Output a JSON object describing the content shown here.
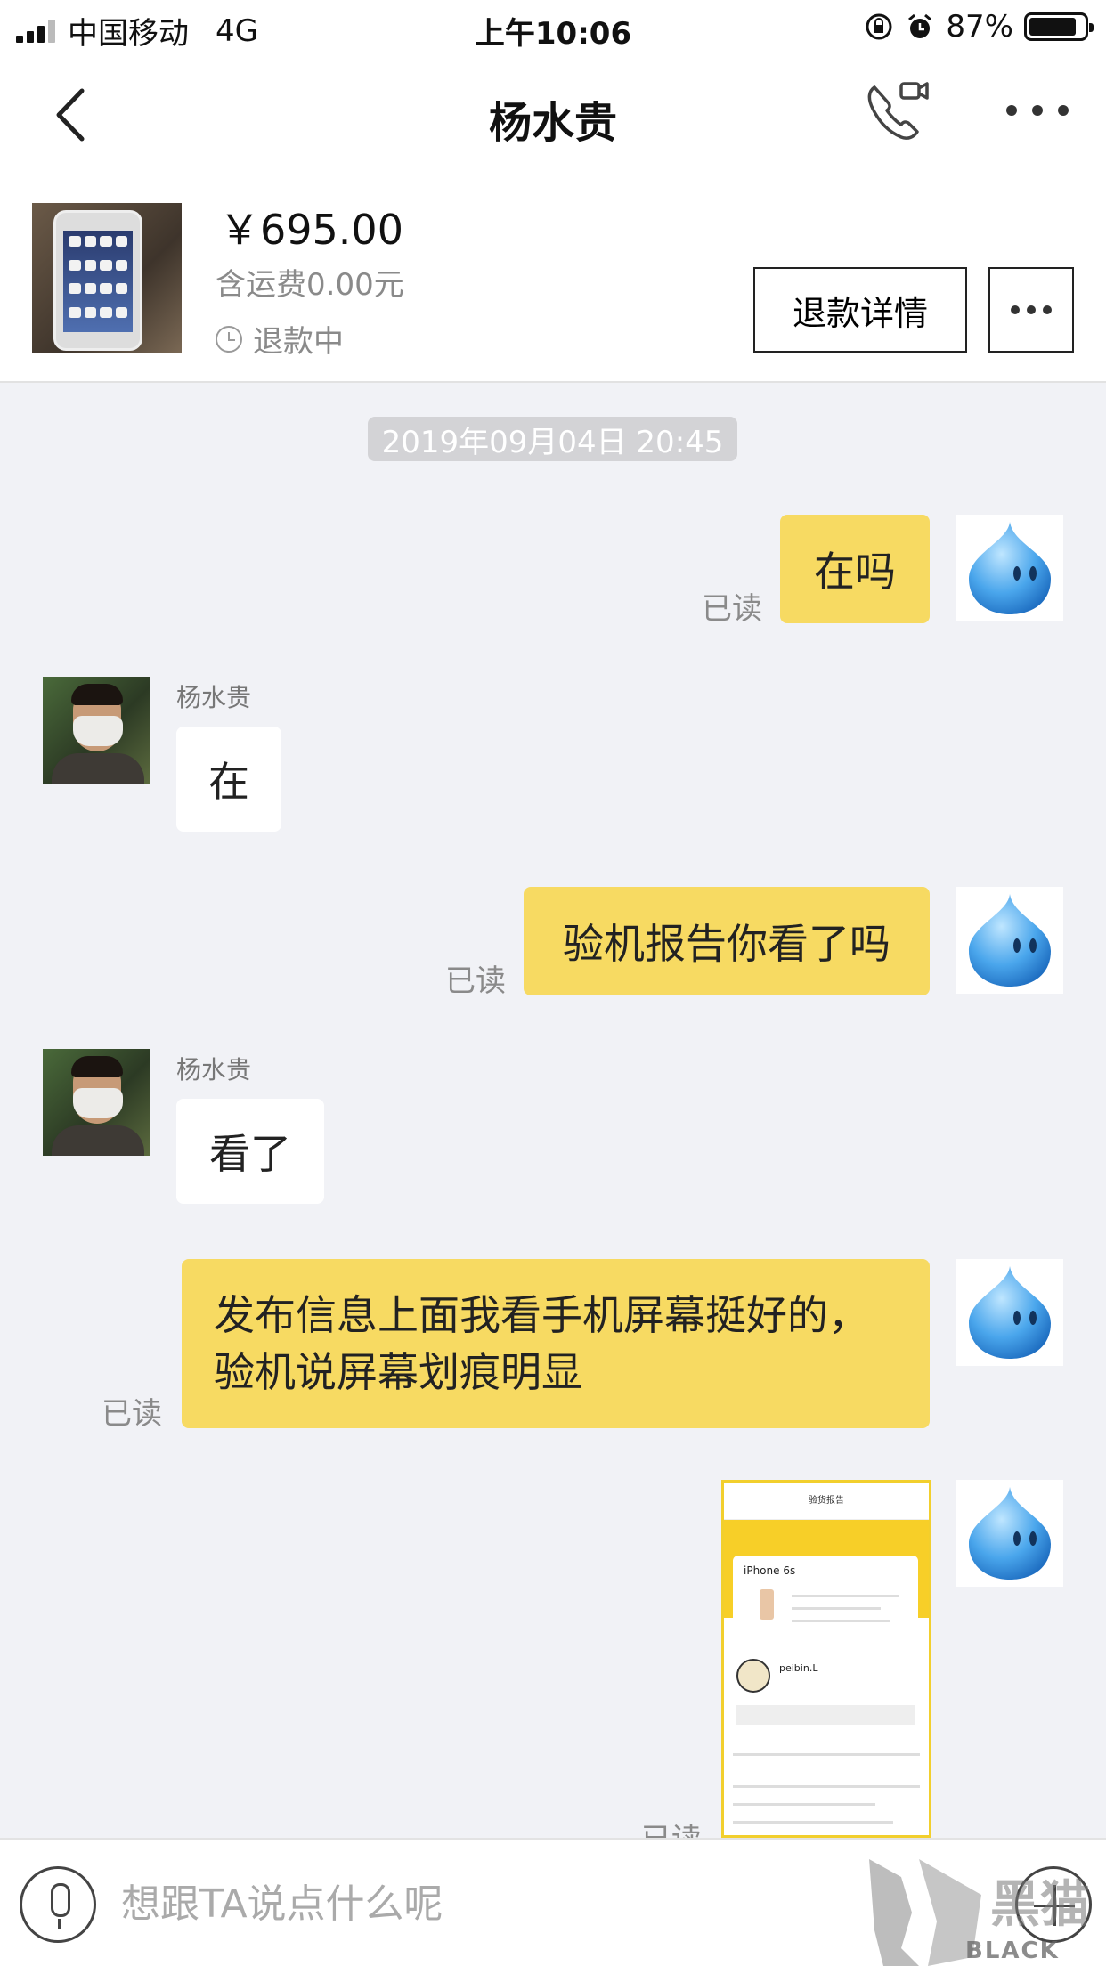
{
  "status_bar": {
    "carrier": "中国移动",
    "network": "4G",
    "time": "上午10:06",
    "battery": "87%",
    "battery_level": 0.87
  },
  "nav": {
    "title": "杨水贵"
  },
  "product": {
    "price": "￥695.00",
    "shipping": "含运费0.00元",
    "status": "退款中",
    "refund_button": "退款详情"
  },
  "chat": {
    "timestamp": "2019年09月04日 20:45",
    "read_label": "已读",
    "messages": [
      {
        "from": "me",
        "text": "在吗"
      },
      {
        "from": "other",
        "sender": "杨水贵",
        "text": "在"
      },
      {
        "from": "me",
        "text": "验机报告你看了吗"
      },
      {
        "from": "other",
        "sender": "杨水贵",
        "text": "看了"
      },
      {
        "from": "me",
        "text_line1": "发布信息上面我看手机屏幕挺好的，",
        "text_line2": "验机说屏幕划痕明显"
      },
      {
        "from": "me",
        "image": {
          "header": "验货报告",
          "model": "iPhone 6s",
          "name": "peibin.L"
        }
      }
    ]
  },
  "input": {
    "placeholder": "想跟TA说点什么呢"
  },
  "watermark": {
    "text": "BLACK CAT"
  },
  "icons": [
    "back-arrow-icon",
    "phone-video-icon",
    "more-dots-icon",
    "clock-icon",
    "mic-icon",
    "plus-icon",
    "droplet-avatar-icon"
  ]
}
